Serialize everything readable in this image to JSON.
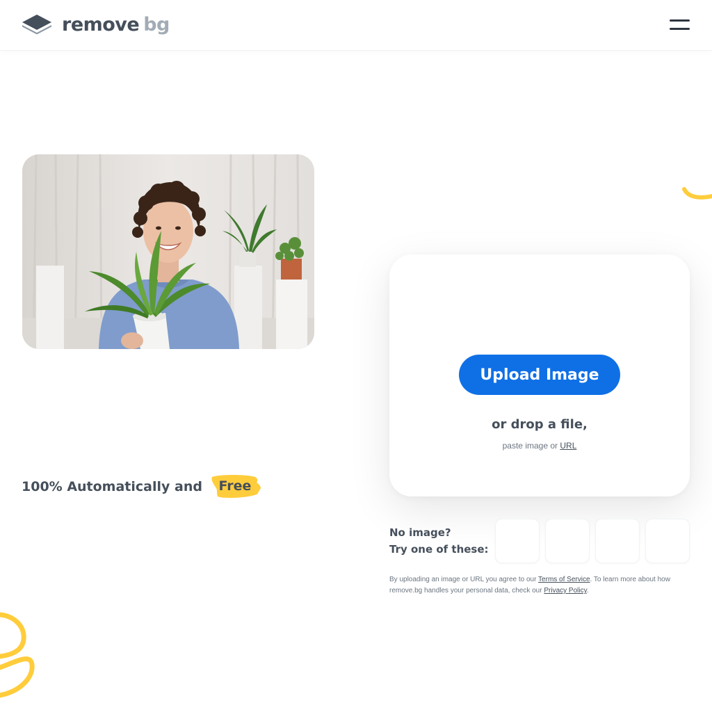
{
  "header": {
    "logo": {
      "word1": "remove",
      "word2": "bg",
      "icon": "layers-logo-icon"
    },
    "menu_icon": "hamburger-menu-icon"
  },
  "hero": {
    "image_description_icon": "hero-photo",
    "tagline": "100% Automatically and",
    "badge": "Free"
  },
  "upload": {
    "button_label": "Upload Image",
    "drop_text": "or drop a file,",
    "paste_prefix": "paste image or",
    "url_link": "URL"
  },
  "samples": {
    "label_line1": "No image?",
    "label_line2": "Try one of these:",
    "count": 4
  },
  "legal": {
    "text1": "By uploading an image or URL you agree to our",
    "tos_link": "Terms of Service",
    "text2": ". To learn more about how remove.bg handles your personal data, check our",
    "privacy_link": "Privacy Policy",
    "text3": "."
  },
  "colors": {
    "primary": "#0f70e6",
    "text": "#454f5b",
    "logo_gray": "#a3acb6",
    "accent_yellow": "#ffcd3c"
  }
}
